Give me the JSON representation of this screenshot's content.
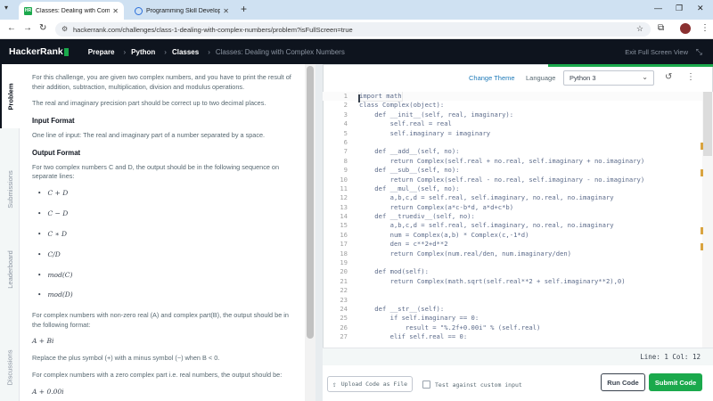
{
  "browser": {
    "tabs": [
      {
        "title": "Classes: Dealing with Complex",
        "active": true
      },
      {
        "title": "Programming Skill Development",
        "active": false
      }
    ],
    "url": "hackerrank.com/challenges/class-1-dealing-with-complex-numbers/problem?isFullScreen=true"
  },
  "nav": {
    "logo": "HackerRank",
    "crumbs": [
      "Prepare",
      "Python",
      "Classes"
    ],
    "current": "Classes: Dealing with Complex Numbers",
    "exit_fullscreen": "Exit Full Screen View"
  },
  "side_tabs": [
    "Problem",
    "Submissions",
    "Leaderboard",
    "Discussions"
  ],
  "problem": {
    "intro": "For this challenge, you are given two complex numbers, and you have to print the result of their addition, subtraction, multiplication, division and modulus operations.",
    "precision": "The real and imaginary precision part should be correct up to two decimal places.",
    "input_heading": "Input Format",
    "input_text": "One line of input: The real and imaginary part of a number separated by a space.",
    "output_heading": "Output Format",
    "output_text": "For two complex numbers C and D, the output should be in the following sequence on separate lines:",
    "ops": [
      "C + D",
      "C − D",
      "C ∗ D",
      "C/D",
      "mod(C)",
      "mod(D)"
    ],
    "nonzero_text": "For complex numbers with non-zero real (A) and complex part(B), the output should be in the following format:",
    "nonzero_format": "A + Bi",
    "replace_text": "Replace the plus symbol (+) with a minus symbol (−) when B < 0.",
    "zero_text": "For complex numbers with a zero complex part i.e. real numbers, the output should be:",
    "zero_format": "A + 0.00i"
  },
  "editor": {
    "change_theme": "Change Theme",
    "language_label": "Language",
    "language": "Python 3",
    "status": "Line: 1 Col: 12",
    "code": [
      "import math",
      "class Complex(object):",
      "    def __init__(self, real, imaginary):",
      "        self.real = real",
      "        self.imaginary = imaginary",
      "",
      "    def __add__(self, no):",
      "        return Complex(self.real + no.real, self.imaginary + no.imaginary)",
      "    def __sub__(self, no):",
      "        return Complex(self.real - no.real, self.imaginary - no.imaginary)",
      "    def __mul__(self, no):",
      "        a,b,c,d = self.real, self.imaginary, no.real, no.imaginary",
      "        return Complex(a*c-b*d, a*d+c*b)",
      "    def __truediv__(self, no):",
      "        a,b,c,d = self.real, self.imaginary, no.real, no.imaginary",
      "        num = Complex(a,b) * Complex(c,-1*d)",
      "        den = c**2+d**2",
      "        return Complex(num.real/den, num.imaginary/den)",
      "",
      "    def mod(self):",
      "        return Complex(math.sqrt(self.real**2 + self.imaginary**2),0)",
      "",
      "",
      "    def __str__(self):",
      "        if self.imaginary == 0:",
      "            result = \"%.2f+0.00i\" % (self.real)",
      "        elif self.real == 0:"
    ]
  },
  "actions": {
    "upload": "Upload Code as File",
    "custom_input": "Test against custom input",
    "run": "Run Code",
    "submit": "Submit Code"
  }
}
